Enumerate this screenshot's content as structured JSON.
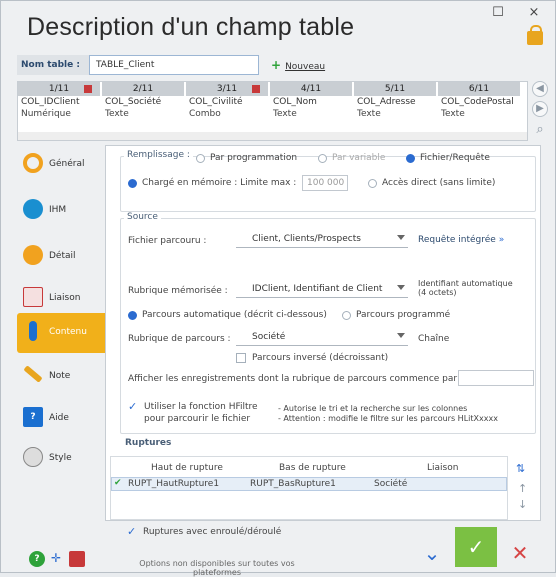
{
  "window": {
    "title": "Description d'un champ table",
    "minimize": "☐",
    "close": "×"
  },
  "header": {
    "name_label": "Nom table :",
    "name_value": "TABLE_Client",
    "new_button": "Nouveau"
  },
  "columns": [
    {
      "index": "1/11",
      "name": "COL_IDClient",
      "type": "Numérique",
      "flag": true
    },
    {
      "index": "2/11",
      "name": "COL_Société",
      "type": "Texte",
      "flag": false
    },
    {
      "index": "3/11",
      "name": "COL_Civilité",
      "type": "Combo",
      "flag": true
    },
    {
      "index": "4/11",
      "name": "COL_Nom",
      "type": "Texte",
      "flag": false
    },
    {
      "index": "5/11",
      "name": "COL_Adresse",
      "type": "Texte",
      "flag": false
    },
    {
      "index": "6/11",
      "name": "COL_CodePostal",
      "type": "Texte",
      "flag": false
    }
  ],
  "sidebar": {
    "items": [
      {
        "label": "Général",
        "icon": "circle-outline-icon",
        "color": "#f1a21f"
      },
      {
        "label": "IHM",
        "icon": "eye-icon",
        "color": "#1a8fd0"
      },
      {
        "label": "Détail",
        "icon": "circle-icon",
        "color": "#f1a21f"
      },
      {
        "label": "Liaison",
        "icon": "document-icon",
        "color": "#c7393a"
      },
      {
        "label": "Contenu",
        "icon": "thermometer-icon",
        "color": "#1a6fd0"
      },
      {
        "label": "Note",
        "icon": "pencil-icon",
        "color": "#e8a51f"
      },
      {
        "label": "Aide",
        "icon": "help-icon",
        "color": "#1a6fd0"
      },
      {
        "label": "Style",
        "icon": "palette-icon",
        "color": "#888888"
      }
    ],
    "active": "Contenu"
  },
  "content": {
    "remplissage_title": "Remplissage :",
    "opt_programmation": "Par programmation",
    "opt_variable": "Par variable",
    "opt_fichier": "Fichier/Requête",
    "charge_memoire": "Chargé en mémoire : Limite max :",
    "limite_placeholder": "100 000",
    "acces_direct": "Accès direct (sans limite)",
    "source_title": "Source",
    "fichier_parcouru_label": "Fichier parcouru :",
    "fichier_parcouru_value": "Client, Clients/Prospects",
    "requete_integree": "Requête intégrée",
    "rubrique_memorisee_label": "Rubrique mémorisée :",
    "rubrique_memorisee_value": "IDClient, Identifiant de Client",
    "identifiant_auto": "Identifiant automatique",
    "octets": "(4 octets)",
    "parcours_auto": "Parcours automatique (décrit ci-dessous)",
    "parcours_programme": "Parcours programmé",
    "rubrique_parcours_label": "Rubrique de parcours :",
    "rubrique_parcours_value": "Société",
    "chaine": "Chaîne",
    "parcours_inverse": "Parcours inversé (décroissant)",
    "afficher_label": "Afficher les enregistrements dont la rubrique de parcours commence par :",
    "hfiltre_line1": "Utiliser la fonction HFiltre",
    "hfiltre_line2": "pour parcourir le fichier",
    "hfiltre_note1": "- Autorise le tri et la recherche sur les colonnes",
    "hfiltre_note2": "- Attention : modifie le filtre sur les parcours HLitXxxxx",
    "ruptures_title": "Ruptures",
    "col_haut": "Haut de rupture",
    "col_bas": "Bas de rupture",
    "col_liaison": "Liaison",
    "row_haut": "RUPT_HautRupture1",
    "row_bas": "RUPT_BasRupture1",
    "row_liaison": "Société",
    "ruptures_enroule": "Ruptures avec enroulé/déroulé"
  },
  "footer": {
    "options_note_1": "Options non disponibles sur toutes vos",
    "options_note_2": "plateformes"
  },
  "colors": {
    "accent": "#f1b01a",
    "ok_green": "#7bc043",
    "cancel_red": "#d64545",
    "link_blue": "#2b6bd0"
  }
}
